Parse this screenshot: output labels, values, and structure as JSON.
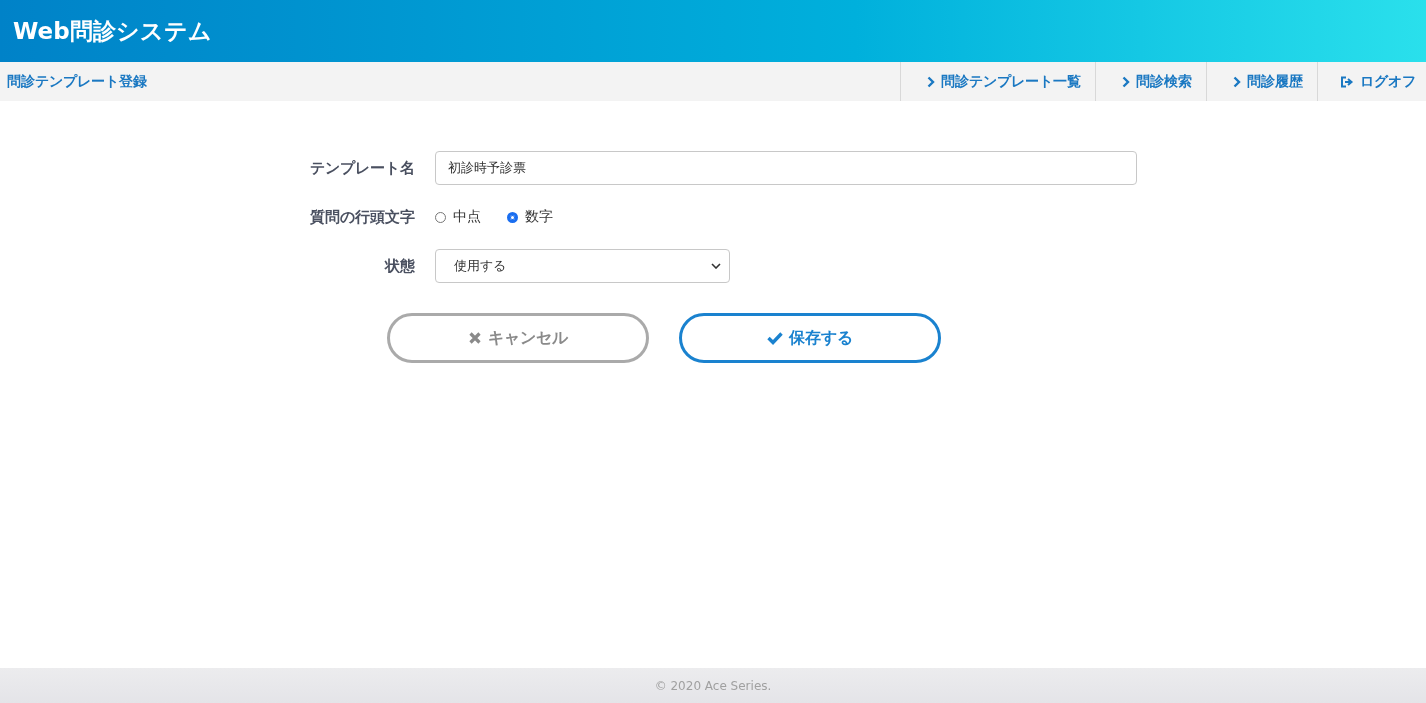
{
  "header": {
    "title": "Web問診システム"
  },
  "subbar": {
    "page_title": "問診テンプレート登録",
    "nav": [
      {
        "kind": "link",
        "label": "問診テンプレート一覧"
      },
      {
        "kind": "link",
        "label": "問診検索"
      },
      {
        "kind": "link",
        "label": "問診履歴"
      },
      {
        "kind": "logout",
        "label": "ログオフ"
      }
    ]
  },
  "form": {
    "template_name": {
      "label": "テンプレート名",
      "value": "初診時予診票"
    },
    "prefix": {
      "label": "質問の行頭文字",
      "options": [
        {
          "label": "中点",
          "selected": false
        },
        {
          "label": "数字",
          "selected": true
        }
      ]
    },
    "status": {
      "label": "状態",
      "value": "使用する"
    }
  },
  "buttons": [
    {
      "kind": "cancel",
      "label": "キャンセル"
    },
    {
      "kind": "save",
      "label": "保存する"
    }
  ],
  "footer": {
    "copyright": "© 2020 Ace Series."
  }
}
